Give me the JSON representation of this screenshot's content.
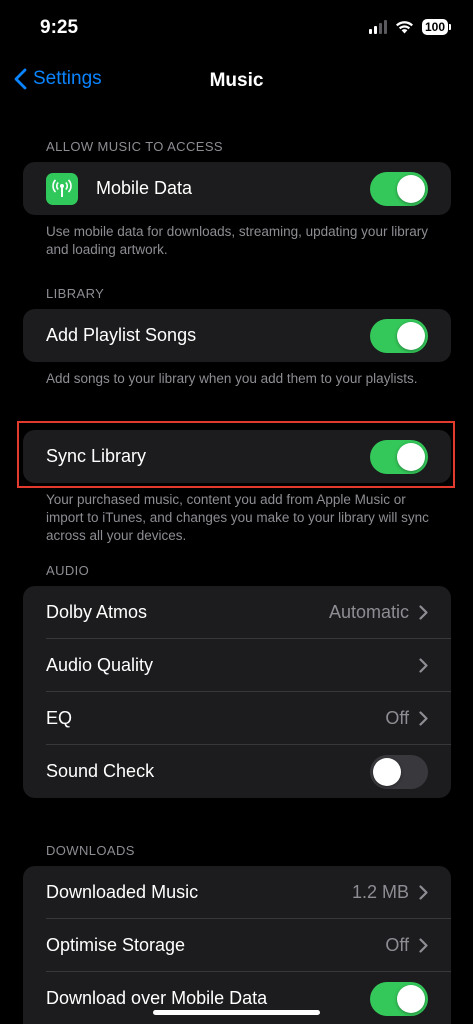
{
  "status_bar": {
    "time": "9:25",
    "battery": "100"
  },
  "nav": {
    "back_label": "Settings",
    "title": "Music"
  },
  "allow_access": {
    "header": "ALLOW MUSIC TO ACCESS",
    "mobile_data": {
      "label": "Mobile Data",
      "on": true,
      "icon": "antenna-icon"
    },
    "footer": "Use mobile data for downloads, streaming, updating your library and loading artwork."
  },
  "library": {
    "header": "LIBRARY",
    "add_playlist_songs": {
      "label": "Add Playlist Songs",
      "on": true
    },
    "add_playlist_footer": "Add songs to your library when you add them to your playlists.",
    "sync_library": {
      "label": "Sync Library",
      "on": true
    },
    "sync_footer": "Your purchased music, content you add from Apple Music or import to iTunes, and changes you make to your library will sync across all your devices."
  },
  "audio": {
    "header": "AUDIO",
    "dolby_atmos": {
      "label": "Dolby Atmos",
      "value": "Automatic"
    },
    "audio_quality": {
      "label": "Audio Quality"
    },
    "eq": {
      "label": "EQ",
      "value": "Off"
    },
    "sound_check": {
      "label": "Sound Check",
      "on": false
    }
  },
  "downloads": {
    "header": "DOWNLOADS",
    "downloaded_music": {
      "label": "Downloaded Music",
      "value": "1.2 MB"
    },
    "optimise_storage": {
      "label": "Optimise Storage",
      "value": "Off"
    },
    "download_mobile": {
      "label": "Download over Mobile Data",
      "on": true
    }
  },
  "colors": {
    "accent": "#0a84ff",
    "toggle_on": "#34c759",
    "highlight": "#e23a2c",
    "cell": "#1c1c1e"
  }
}
